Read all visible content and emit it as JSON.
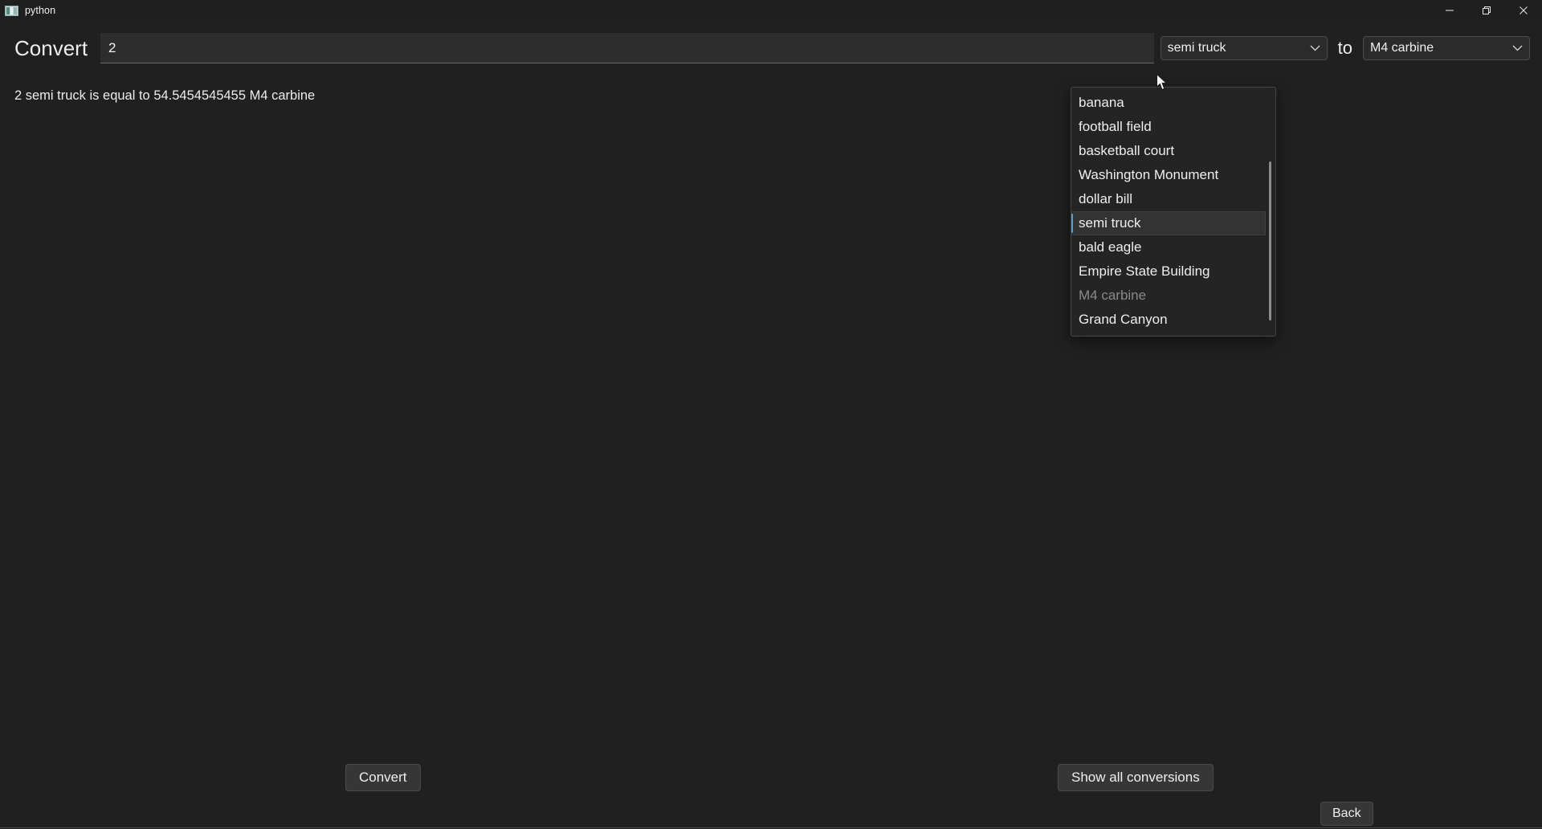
{
  "window": {
    "title": "python",
    "icon": "python-window-icon",
    "controls": {
      "minimize": "minimize-icon",
      "maximize": "restore-icon",
      "close": "close-icon"
    }
  },
  "main": {
    "convert_label": "Convert",
    "amount_value": "2",
    "amount_placeholder": "",
    "to_label": "to",
    "from_unit": "semi truck",
    "to_unit": "M4 carbine",
    "result_text": "2 semi truck is equal to 54.5454545455 M4 carbine",
    "result_parts": {
      "amount": "2",
      "from_unit": "semi truck",
      "connector": "is equal to",
      "value": "54.5454545455",
      "to_unit": "M4 carbine"
    }
  },
  "from_dropdown": {
    "open": true,
    "selected": "semi truck",
    "disabled_option": "M4 carbine",
    "chevron_icon": "chevron-down-icon",
    "options": [
      {
        "label": "banana",
        "state": "normal"
      },
      {
        "label": "football field",
        "state": "normal"
      },
      {
        "label": "basketball court",
        "state": "normal"
      },
      {
        "label": "Washington Monument",
        "state": "normal"
      },
      {
        "label": "dollar bill",
        "state": "normal"
      },
      {
        "label": "semi truck",
        "state": "selected"
      },
      {
        "label": "bald eagle",
        "state": "normal"
      },
      {
        "label": "Empire State Building",
        "state": "normal"
      },
      {
        "label": "M4 carbine",
        "state": "disabled"
      },
      {
        "label": "Grand Canyon",
        "state": "normal"
      }
    ]
  },
  "to_dropdown": {
    "open": false,
    "selected": "M4 carbine",
    "chevron_icon": "chevron-down-icon"
  },
  "buttons": {
    "convert": "Convert",
    "show_all": "Show all conversions",
    "back": "Back"
  },
  "colors": {
    "window_background": "#202020",
    "titlebar_background": "#1f1f1f",
    "text": "#ececec",
    "field_background": "#2d2d2d",
    "button_background": "#363636",
    "dropdown_background": "#242424",
    "selection_accent": "#4aa3d8",
    "disabled_text": "#8a8a8a",
    "close_hover": "#c42b1c"
  }
}
